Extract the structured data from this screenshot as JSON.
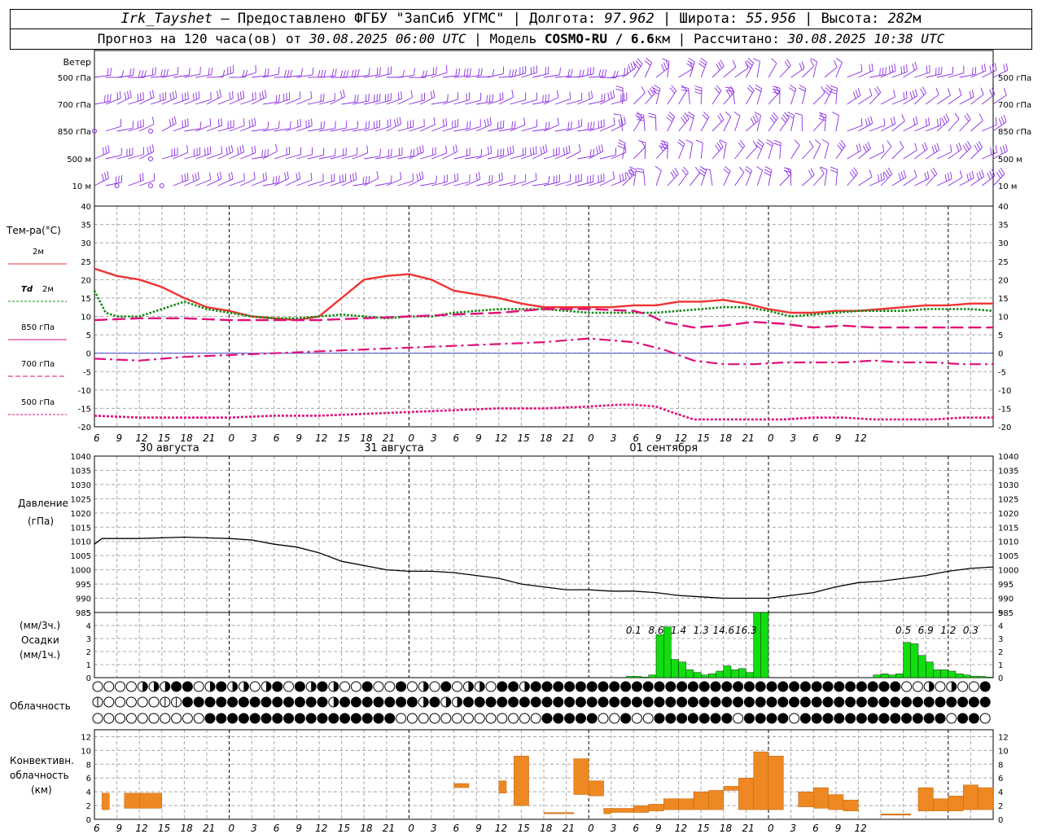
{
  "header": {
    "station": "Irk_Tayshet",
    "dash": "–",
    "provided": "Предоставлено ФГБУ \"ЗапСиб УГМС\"",
    "sep": "|",
    "lon_label": "Долгота:",
    "lon_value": "97.962",
    "lat_label": "Широта:",
    "lat_value": "55.956",
    "alt_label": "Высота:",
    "alt_value": "282",
    "alt_unit": "м",
    "forecast_prefix": "Прогноз на 120 часа(ов) от",
    "forecast_from": "30.08.2025 06:00 UTC",
    "model_label": "Модель",
    "model_value": "COSMO-RU / 6.6",
    "model_unit": "км",
    "computed_label": "Рассчитано:",
    "computed_value": "30.08.2025 10:38 UTC"
  },
  "colors": {
    "wind": "#8a2be2",
    "t2m": "#ee3333",
    "td2m": "#118811",
    "t850": "#e0107a",
    "grid": "#a8a8a8",
    "precip": "#11dd11",
    "convective": "#ee8822"
  },
  "chart_data": [
    {
      "type": "wind-barbs",
      "title": "Ветер",
      "levels": [
        "500 гПа",
        "700 гПа",
        "850 гПа",
        "500 м",
        "10 м"
      ]
    },
    {
      "type": "line",
      "ylabel": "Тем-ра(°C)",
      "ylim": [
        -20,
        40
      ],
      "yticks": [
        -20,
        -15,
        -10,
        -5,
        0,
        5,
        10,
        15,
        20,
        25,
        30,
        35,
        40
      ],
      "x_hours": [
        0,
        12,
        24,
        36,
        48,
        60,
        72,
        84,
        96,
        108,
        120
      ],
      "x_tick_labels": [
        "6",
        "9",
        "12",
        "15",
        "18",
        "21",
        "0",
        "3",
        "6",
        "9",
        "12",
        "15",
        "18",
        "21",
        "0",
        "3",
        "6",
        "9",
        "12",
        "15",
        "18",
        "21",
        "0",
        "3",
        "6",
        "9",
        "12",
        "15",
        "18",
        "21",
        "0",
        "3",
        "6",
        "9",
        "12"
      ],
      "dates": [
        "30 августа",
        "31 августа",
        "01 сентября"
      ],
      "series": [
        {
          "name": "2м",
          "style": "solid",
          "x": [
            0,
            3,
            6,
            9,
            12,
            15,
            18,
            21,
            24,
            27,
            30,
            33,
            36,
            39,
            42,
            45,
            48,
            51,
            54,
            57,
            60,
            63,
            66,
            69,
            72,
            75,
            78,
            81,
            84,
            87,
            90,
            93,
            96,
            99,
            102,
            105,
            108,
            111,
            114,
            117,
            120
          ],
          "values": [
            23,
            21,
            20,
            18,
            15,
            12.5,
            11.5,
            10,
            9.5,
            9,
            10,
            15,
            20,
            21,
            21.5,
            20,
            17,
            16,
            15,
            13.5,
            12.5,
            12.5,
            12.5,
            12.5,
            13,
            13,
            14,
            14,
            14.5,
            13.5,
            12,
            11,
            11,
            11.5,
            11.5,
            12,
            12.5,
            13,
            13,
            13.5,
            13.5
          ]
        },
        {
          "name": "2м",
          "style": "dotted",
          "label_prefix": "Td",
          "x": [
            0,
            1.5,
            3,
            6,
            9,
            12,
            15,
            18,
            21,
            24,
            27,
            30,
            33,
            36,
            39,
            42,
            45,
            48,
            51,
            54,
            57,
            60,
            63,
            66,
            69,
            72,
            75,
            78,
            81,
            84,
            87,
            90,
            93,
            96,
            99,
            102,
            105,
            108,
            111,
            114,
            117,
            120
          ],
          "values": [
            17,
            11,
            10,
            10,
            12,
            14,
            12,
            11,
            10,
            9.5,
            9.5,
            10,
            10.5,
            10,
            9.5,
            10,
            10,
            11,
            11.5,
            12,
            12,
            12,
            11.5,
            11,
            11,
            11,
            11,
            11.5,
            12,
            12.5,
            12.5,
            11.5,
            10,
            10.5,
            11,
            11.5,
            11.5,
            11.5,
            12,
            12,
            12,
            11.5
          ]
        },
        {
          "name": "850 гПа",
          "style": "longdash",
          "x": [
            0,
            6,
            12,
            18,
            24,
            30,
            36,
            42,
            48,
            54,
            60,
            66,
            72,
            74,
            76,
            80,
            84,
            88,
            92,
            96,
            100,
            104,
            108,
            112,
            116,
            120
          ],
          "values": [
            9,
            9.5,
            9.5,
            9,
            9,
            9,
            9.5,
            10,
            10.5,
            11,
            12,
            12,
            11.5,
            10.5,
            8.5,
            7,
            7.5,
            8.5,
            8,
            7,
            7.5,
            7,
            7,
            7,
            7,
            7
          ]
        },
        {
          "name": "700 гПа",
          "style": "dashdot",
          "x": [
            0,
            6,
            12,
            18,
            24,
            30,
            36,
            42,
            48,
            54,
            60,
            66,
            72,
            76,
            80,
            84,
            88,
            92,
            96,
            100,
            104,
            108,
            112,
            116,
            120
          ],
          "values": [
            -1.5,
            -2,
            -1,
            -0.5,
            0,
            0.5,
            1,
            1.5,
            2,
            2.5,
            3,
            4,
            3,
            1,
            -2,
            -3,
            -3,
            -2.5,
            -2.5,
            -2.5,
            -2,
            -2.5,
            -2.5,
            -3,
            -3
          ]
        },
        {
          "name": "500 гПа",
          "style": "dotted",
          "x": [
            0,
            6,
            12,
            18,
            24,
            30,
            36,
            42,
            48,
            54,
            60,
            66,
            70,
            72,
            75,
            77,
            80,
            84,
            88,
            92,
            96,
            100,
            104,
            108,
            112,
            116,
            120
          ],
          "values": [
            -17,
            -17.5,
            -17.5,
            -17.5,
            -17,
            -17,
            -16.5,
            -16,
            -15.5,
            -15,
            -15,
            -14.5,
            -14,
            -14,
            -14.5,
            -16,
            -18,
            -18,
            -18,
            -18,
            -17.5,
            -17.5,
            -18,
            -18,
            -18,
            -17.5,
            -17.5
          ]
        }
      ]
    },
    {
      "type": "line",
      "ylabel": "Давление",
      "yunit": "(гПа)",
      "ylim": [
        985,
        1040
      ],
      "yticks": [
        985,
        990,
        995,
        1000,
        1005,
        1010,
        1015,
        1020,
        1025,
        1030,
        1035,
        1040
      ],
      "series": [
        {
          "x": [
            0,
            1,
            3,
            6,
            12,
            18,
            21,
            24,
            27,
            30,
            33,
            36,
            39,
            42,
            45,
            48,
            51,
            54,
            57,
            60,
            63,
            66,
            69,
            72,
            75,
            78,
            81,
            84,
            87,
            90,
            93,
            96,
            99,
            102,
            105,
            108,
            111,
            114,
            117,
            120
          ],
          "values": [
            1009,
            1011,
            1011,
            1011,
            1011.5,
            1011,
            1010.5,
            1009,
            1008,
            1006,
            1003,
            1001.5,
            1000,
            999.5,
            999.5,
            999,
            998,
            997,
            995,
            994,
            993,
            993,
            992.5,
            992.5,
            992,
            991,
            990.5,
            990,
            990,
            990,
            991,
            992,
            994,
            995.5,
            996,
            997,
            998,
            999.5,
            1000.5,
            1001
          ]
        }
      ]
    },
    {
      "type": "bar",
      "ylabel": "(мм/3ч.)",
      "title": "Осадки",
      "yunit": "(мм/1ч.)",
      "ylim": [
        0,
        5
      ],
      "yticks": [
        0,
        1,
        2,
        3,
        4,
        5
      ],
      "x": [
        70,
        71,
        72,
        73,
        74,
        75,
        76,
        77,
        78,
        79,
        80,
        81,
        82,
        83,
        84,
        85,
        86,
        87,
        88,
        89,
        90,
        91,
        92,
        93,
        94,
        95,
        96,
        97,
        98,
        99,
        100,
        101,
        102,
        103,
        104,
        105,
        106,
        107,
        108,
        109,
        110,
        111,
        112,
        113,
        114,
        115,
        116,
        117,
        118,
        119
      ],
      "values": [
        0,
        0.1,
        0.1,
        0.05,
        0.2,
        3.3,
        3.9,
        1.4,
        1.2,
        0.6,
        0.4,
        0.2,
        0.3,
        0.5,
        0.9,
        0.6,
        0.7,
        0.4,
        6.2,
        6.5,
        0,
        0,
        0,
        0,
        0,
        0,
        0,
        0,
        0,
        0,
        0,
        0,
        0,
        0,
        0.2,
        0.3,
        0.2,
        0.3,
        2.7,
        2.6,
        1.7,
        1.2,
        0.6,
        0.6,
        0.5,
        0.3,
        0.2,
        0.1,
        0.1,
        0.05
      ],
      "annotations": [
        {
          "x": 72,
          "text": "0.1"
        },
        {
          "x": 75,
          "text": "8.6"
        },
        {
          "x": 78,
          "text": "1.4"
        },
        {
          "x": 81,
          "text": "1.3"
        },
        {
          "x": 84,
          "text": "14.6"
        },
        {
          "x": 87,
          "text": "16.3"
        },
        {
          "x": 108,
          "text": "0.5"
        },
        {
          "x": 111,
          "text": "6.9"
        },
        {
          "x": 114,
          "text": "1.2"
        },
        {
          "x": 117,
          "text": "0.3"
        }
      ]
    },
    {
      "type": "table",
      "title": "Облачность",
      "rows": 3,
      "columns": 41
    },
    {
      "type": "bar",
      "ylabel": "Конвективн. облачность (км)",
      "ylabel_lines": [
        "Конвективн.",
        "облачность",
        "(км)"
      ],
      "ylim": [
        0,
        13
      ],
      "yticks": [
        0,
        2,
        4,
        6,
        8,
        10,
        12
      ],
      "bars": [
        [
          1,
          2,
          1.4,
          3.8
        ],
        [
          4,
          6,
          1.6,
          3.8
        ],
        [
          6,
          9,
          1.6,
          3.8
        ],
        [
          48,
          50,
          4.6,
          5.2
        ],
        [
          54,
          55,
          3.8,
          5.6
        ],
        [
          56,
          58,
          2.0,
          9.2
        ],
        [
          60,
          64,
          0.8,
          1.0
        ],
        [
          64,
          66,
          3.6,
          8.8
        ],
        [
          66,
          68,
          3.4,
          5.6
        ],
        [
          68,
          69,
          0.8,
          1.6
        ],
        [
          69,
          72,
          1.0,
          1.6
        ],
        [
          72,
          74,
          1.0,
          2.0
        ],
        [
          74,
          76,
          1.2,
          2.2
        ],
        [
          76,
          78,
          1.4,
          3.0
        ],
        [
          78,
          80,
          1.4,
          3.0
        ],
        [
          80,
          82,
          1.4,
          4.0
        ],
        [
          82,
          84,
          1.4,
          4.2
        ],
        [
          84,
          86,
          4.2,
          4.8
        ],
        [
          86,
          88,
          1.4,
          6.0
        ],
        [
          88,
          90,
          1.4,
          9.8
        ],
        [
          90,
          92,
          1.4,
          9.2
        ],
        [
          94,
          96,
          1.8,
          4.0
        ],
        [
          96,
          98,
          1.6,
          4.6
        ],
        [
          98,
          100,
          1.4,
          3.6
        ],
        [
          100,
          102,
          1.2,
          2.8
        ],
        [
          105,
          106,
          0.6,
          0.8
        ],
        [
          106,
          109,
          0.6,
          0.8
        ],
        [
          110,
          112,
          1.2,
          4.6
        ],
        [
          112,
          114,
          1.2,
          3.0
        ],
        [
          114,
          116,
          1.2,
          3.4
        ],
        [
          116,
          118,
          1.4,
          5.0
        ],
        [
          118,
          120,
          1.4,
          4.6
        ]
      ]
    }
  ]
}
